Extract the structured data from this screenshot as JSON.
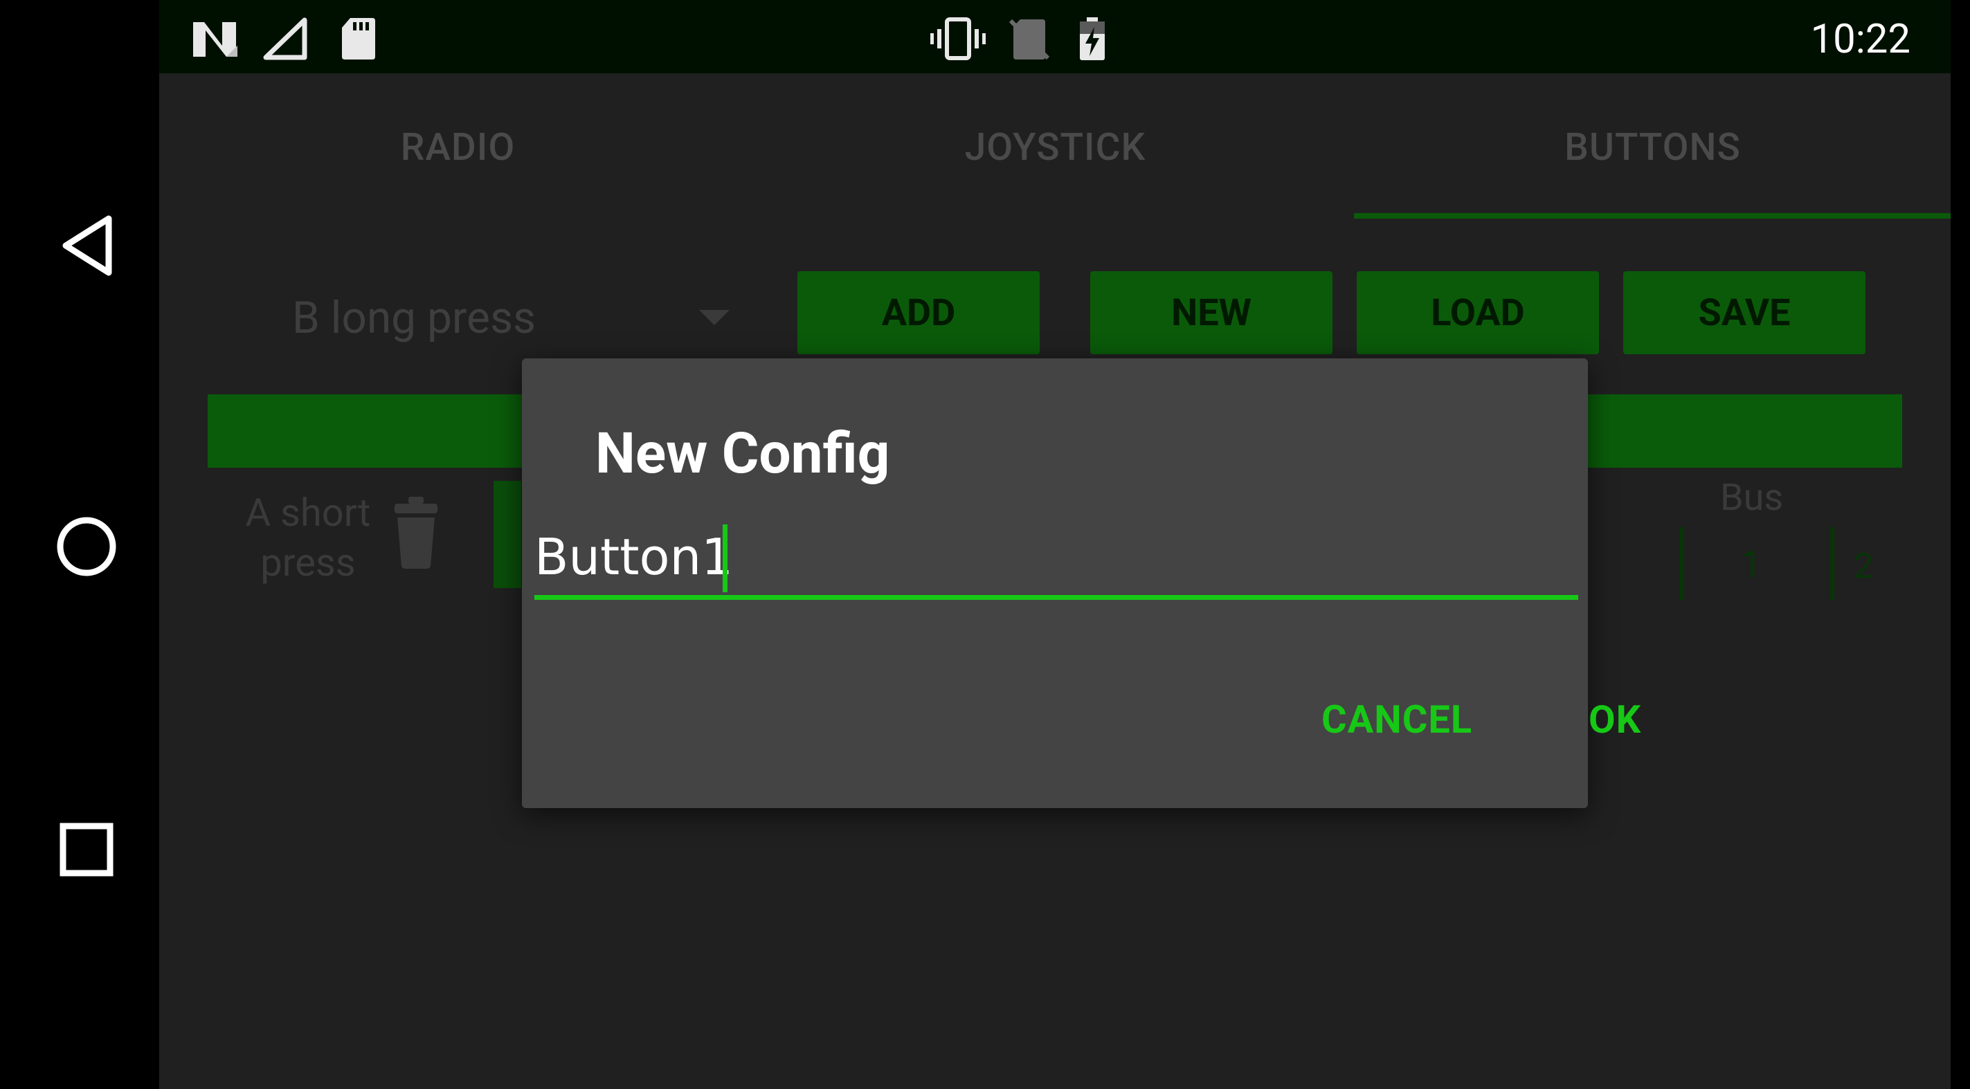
{
  "status_bar": {
    "time": "10:22",
    "icons": [
      "n-notification-icon",
      "cell-signal-icon",
      "sd-card-icon",
      "vibrate-icon",
      "no-sim-icon",
      "battery-charging-icon"
    ]
  },
  "nav_bar": {
    "icons": [
      "back-icon",
      "home-icon",
      "recents-icon"
    ]
  },
  "tabs": [
    {
      "label": "RADIO",
      "active": false
    },
    {
      "label": "JOYSTICK",
      "active": false
    },
    {
      "label": "BUTTONS",
      "active": true
    }
  ],
  "toolbar": {
    "spinner_value": "B long press",
    "add_label": "ADD",
    "new_label": "NEW",
    "load_label": "LOAD",
    "save_label": "SAVE"
  },
  "list": {
    "row_label": "A short press",
    "bus_header": "Bus",
    "bus_values": [
      "1",
      "2"
    ]
  },
  "dialog": {
    "title": "New Config",
    "input_value": "Button1",
    "cancel_label": "CANCEL",
    "ok_label": "OK"
  },
  "colors": {
    "accent": "#17c817",
    "dialog_bg": "#444444",
    "app_bg": "#202020",
    "dimmed_green": "#0a5a0a"
  }
}
